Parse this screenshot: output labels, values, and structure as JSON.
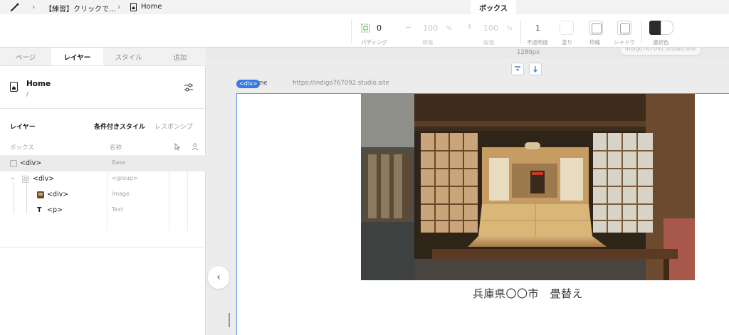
{
  "topbar": {
    "project_name": "【練習】クリックで...",
    "page_name": "Home",
    "active_panel_tab": "ボックス"
  },
  "toolbar": {
    "padding": {
      "value": "0",
      "label": "パディング"
    },
    "width": {
      "value": "100",
      "unit": "%",
      "label": "横幅"
    },
    "height": {
      "value": "100",
      "unit": "%",
      "label": "縦幅"
    },
    "opacity": {
      "value": "1",
      "label": "不透明度"
    },
    "fill": {
      "label": "塗り"
    },
    "border": {
      "label": "枠線"
    },
    "shadow": {
      "label": "シャドウ"
    },
    "selection_color": {
      "label": "選択色"
    }
  },
  "panel": {
    "tabs": [
      {
        "label": "ページ",
        "active": false
      },
      {
        "label": "レイヤー",
        "active": true
      },
      {
        "label": "スタイル",
        "active": false
      },
      {
        "label": "追加",
        "active": false
      }
    ],
    "page": {
      "title": "Home",
      "path": "/"
    },
    "layers_heading": "レイヤー",
    "conditional_style": "条件付きスタイル",
    "responsive": "レスポンシブ",
    "columns": {
      "box": "ボックス",
      "name": "名称"
    },
    "layers": [
      {
        "name": "<div>",
        "style": "Base"
      },
      {
        "name": "<div>",
        "style": "<group>"
      },
      {
        "name": "<div>",
        "style": "Image"
      },
      {
        "name": "<p>",
        "style": "Text"
      }
    ]
  },
  "canvas": {
    "width_label": "1280px",
    "ghost_url": "indigo767092.studio.site",
    "frame_badge": "<div>",
    "frame_name": "me",
    "frame_url": "https://indigo767092.studio.site",
    "caption": "兵庫県〇〇市　畳替え"
  },
  "colors": {
    "accent": "#3b7be0",
    "selection_border": "#5b9bea",
    "panel_bg": "#ffffff",
    "canvas_bg": "#ececec"
  }
}
